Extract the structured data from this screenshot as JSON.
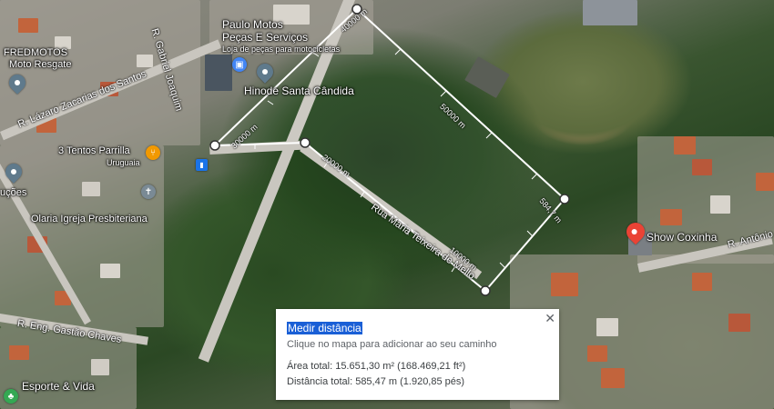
{
  "places": {
    "paulo_motos_line1": "Paulo Motos",
    "paulo_motos_line2": "Peças E Serviços",
    "paulo_motos_sub": "Loja de peças para motocicletas",
    "hinode": "Hinode Santa Cândida",
    "fredmotos_line1": "FREDMOTOS",
    "fredmotos_line2": "Moto Resgate",
    "tentos": "3 Tentos Parrilla",
    "tentos_sub": "Uruguaia",
    "olaria": "Olaria Igreja Presbiteriana",
    "partial_left": "uções",
    "show_coxinha": "Show Coxinha",
    "esporte": "Esporte & Vida"
  },
  "roads": {
    "lazaro": "R. Lázaro Zacarias dos Santos",
    "gabriel": "R. Gabriel Joaquim",
    "maria": "Rua Maria Teixeira de Mello",
    "gastao": "R. Eng. Gastão Chaves",
    "antonio": "R. Antônio"
  },
  "measurements": {
    "m40000": "40000 m",
    "m30000": "30000 m",
    "m20000": "20000 m",
    "m50000": "50000 m",
    "m5847": "584,7 m",
    "m10000": "10000 m"
  },
  "panel": {
    "title": "Medir distância",
    "subtitle": "Clique no mapa para adicionar ao seu caminho",
    "area": "Área total: 15.651,30 m² (168.469,21 ft²)",
    "distance": "Distância total: 585,47 m (1.920,85 pés)",
    "close": "✕"
  },
  "colors": {
    "pin_red": "#ea4335",
    "pin_gray": "#5f7a8c",
    "shopping_blue": "#4285f4",
    "restaurant_orange": "#f29900",
    "church_gray": "#7a8a95",
    "recreation_green": "#34a853",
    "highlight_blue": "#1a5fd6"
  },
  "icons": [
    "location-pin-icon",
    "shopping-bag-icon",
    "fork-knife-icon",
    "church-icon",
    "bus-stop-icon",
    "park-icon",
    "close-icon"
  ]
}
